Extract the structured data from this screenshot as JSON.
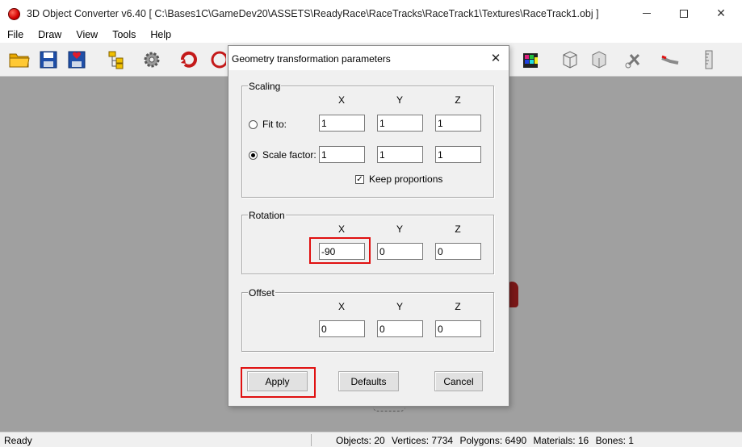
{
  "window": {
    "title": "3D Object Converter v6.40    [ C:\\Bases1C\\GameDev20\\ASSETS\\ReadyRace\\RaceTracks\\RaceTrack1\\Textures\\RaceTrack1.obj ]",
    "min_glyph": "",
    "close_glyph": "✕"
  },
  "menu": [
    "File",
    "Draw",
    "View",
    "Tools",
    "Help"
  ],
  "toolbar": {
    "icons": [
      "open-folder-icon",
      "save-icon",
      "save-as-icon",
      "hierarchy-icon",
      "settings-gear-icon",
      "rotate-object-icon",
      "cube-icon",
      "color-cube-icon",
      "wireframe-box-icon",
      "plane-box-icon",
      "scissors-icon",
      "brush-icon",
      "ruler-icon"
    ]
  },
  "dialog": {
    "title": "Geometry transformation parameters",
    "close_glyph": "✕",
    "scaling": {
      "label": "Scaling",
      "headers": [
        "X",
        "Y",
        "Z"
      ],
      "fit_label": "Fit to:",
      "fit_values": [
        "1",
        "1",
        "1"
      ],
      "scale_label": "Scale factor:",
      "scale_values": [
        "1",
        "1",
        "1"
      ],
      "selected": "scale_factor",
      "keep_label": "Keep proportions",
      "keep_checked": true
    },
    "rotation": {
      "label": "Rotation",
      "headers": [
        "X",
        "Y",
        "Z"
      ],
      "values": [
        "-90",
        "0",
        "0"
      ]
    },
    "offset": {
      "label": "Offset",
      "headers": [
        "X",
        "Y",
        "Z"
      ],
      "values": [
        "0",
        "0",
        "0"
      ]
    },
    "buttons": {
      "apply": "Apply",
      "defaults": "Defaults",
      "cancel": "Cancel"
    }
  },
  "status": {
    "ready": "Ready",
    "objects": "Objects: 20",
    "vertices": "Vertices: 7734",
    "polygons": "Polygons: 6490",
    "materials": "Materials: 16",
    "bones": "Bones: 1"
  },
  "colors": {
    "highlight": "#e01010",
    "viewport": "#a0a0a0"
  }
}
